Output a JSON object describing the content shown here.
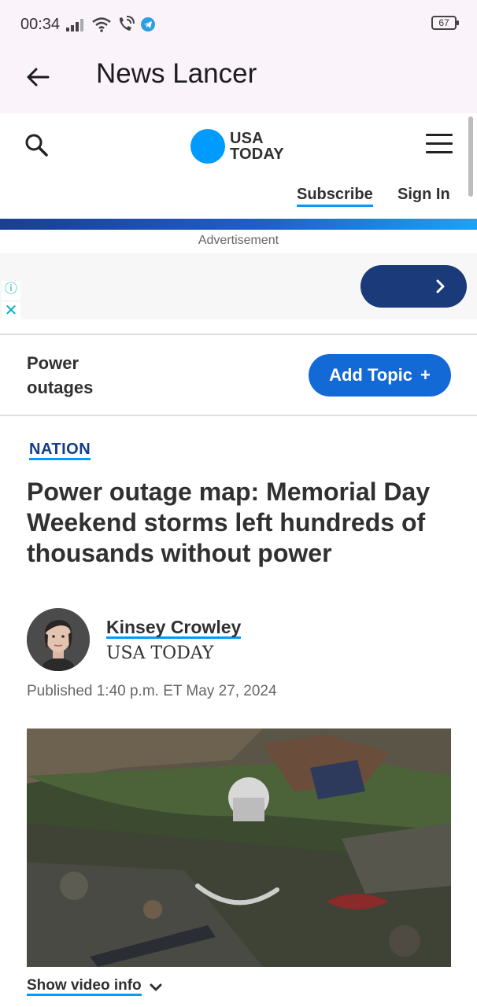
{
  "status_bar": {
    "time": "00:34",
    "battery": "67",
    "icons": [
      "signal-icon",
      "wifi-icon",
      "wifi-call-icon",
      "telegram-icon"
    ]
  },
  "app_bar": {
    "title": "News Lancer",
    "back_icon": "arrow-left-icon"
  },
  "site_header": {
    "logo_line1": "USA",
    "logo_line2": "TODAY",
    "logo_color": "#009bff",
    "subscribe_label": "Subscribe",
    "signin_label": "Sign In"
  },
  "ad": {
    "label": "Advertisement",
    "info_icon": "info-icon",
    "close_icon": "close-icon",
    "cta_icon": "chevron-right-icon"
  },
  "topic": {
    "name": "Power outages",
    "add_label": "Add Topic",
    "add_icon": "+"
  },
  "article": {
    "section": "NATION",
    "headline": "Power outage map: Memorial Day Weekend storms left hundreds of thousands without power",
    "author": "Kinsey Crowley",
    "outlet": "USA TODAY",
    "published": "Published 1:40 p.m. ET May 27, 2024"
  },
  "video": {
    "show_info_label": "Show video info",
    "toggle_icon": "chevron-down-icon"
  },
  "colors": {
    "accent": "#009bff",
    "brand_dark": "#133c8b",
    "button_blue": "#1369d6",
    "app_bar_bg": "#fbf3fa"
  }
}
